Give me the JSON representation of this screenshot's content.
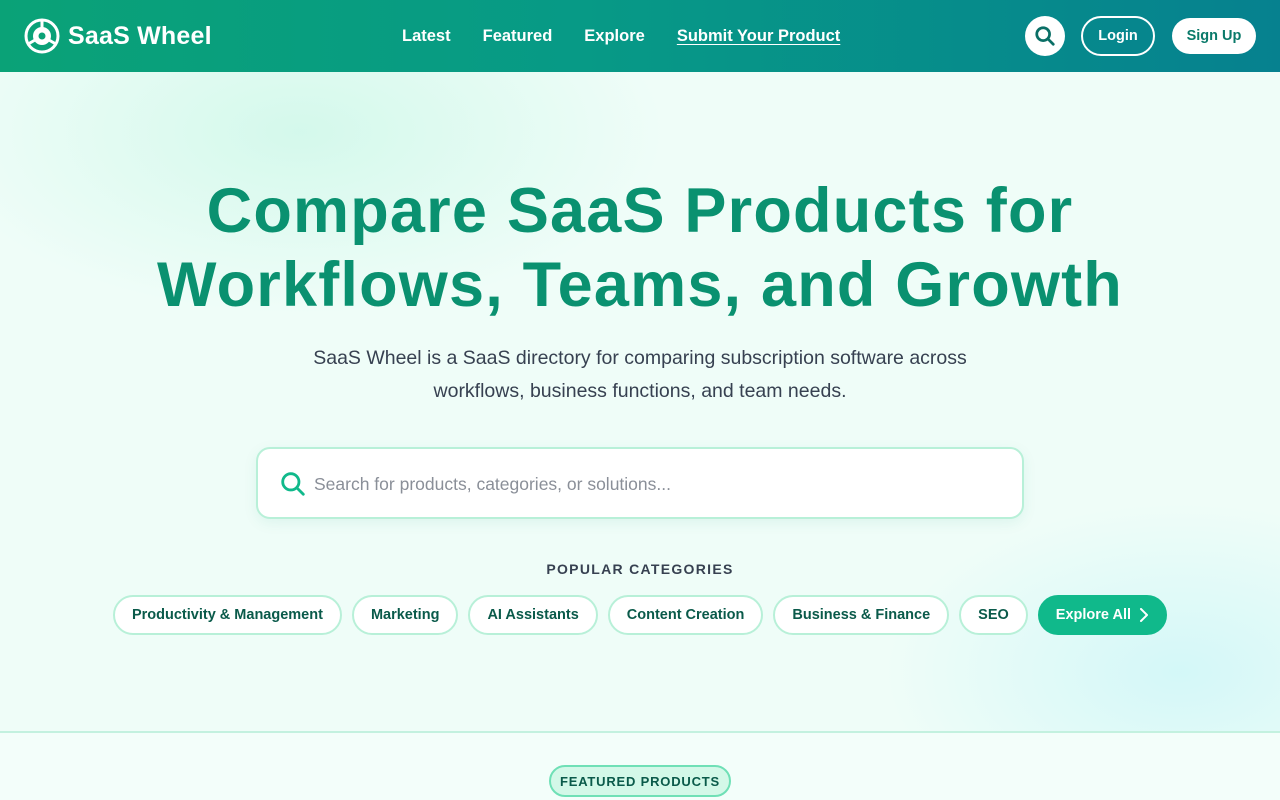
{
  "brand": {
    "name": "SaaS Wheel"
  },
  "nav": {
    "items": [
      {
        "label": "Latest"
      },
      {
        "label": "Featured"
      },
      {
        "label": "Explore"
      },
      {
        "label": "Submit Your Product"
      }
    ]
  },
  "header_actions": {
    "login_label": "Login",
    "signup_label": "Sign Up"
  },
  "hero": {
    "title_line1": "Compare SaaS Products for",
    "title_line2": "Workflows, Teams, and Growth",
    "subtitle_line1": "SaaS Wheel is a SaaS directory for comparing subscription software across",
    "subtitle_line2": "workflows, business functions, and team needs."
  },
  "search": {
    "placeholder": "Search for products, categories, or solutions...",
    "value": ""
  },
  "popular": {
    "label": "POPULAR CATEGORIES",
    "categories": [
      {
        "label": "Productivity & Management"
      },
      {
        "label": "Marketing"
      },
      {
        "label": "AI Assistants"
      },
      {
        "label": "Content Creation"
      },
      {
        "label": "Business & Finance"
      },
      {
        "label": "SEO"
      }
    ],
    "explore_all_label": "Explore All"
  },
  "featured": {
    "badge_label": "FEATURED PRODUCTS"
  },
  "colors": {
    "brand_green": "#0a9170",
    "accent": "#10b98b",
    "header_start": "#0aa277",
    "header_end": "#06818f"
  },
  "icons": {
    "logo": "wheel-logo-icon",
    "search": "search-icon",
    "chevron": "chevron-right-icon"
  }
}
